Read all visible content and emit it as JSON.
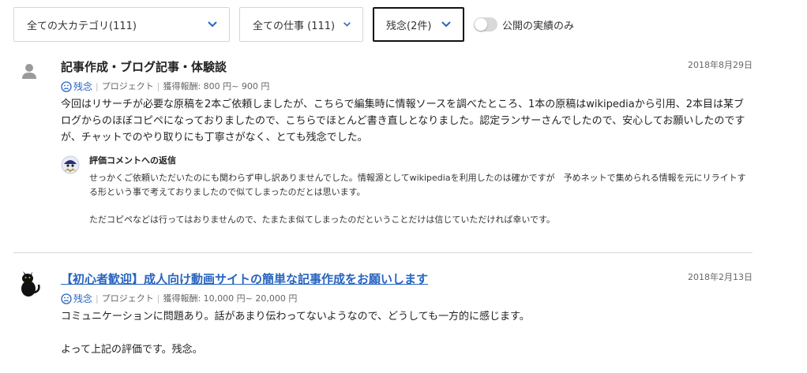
{
  "filters": {
    "category_label": "全ての大カテゴリ(111)",
    "work_label": "全ての仕事 (111)",
    "rating_label": "残念(2件)",
    "public_only_label": "公開の実績のみ",
    "public_only_on": false
  },
  "reviews": [
    {
      "title": "記事作成・ブログ記事・体験談",
      "date": "2018年8月29日",
      "rating": "残念",
      "type": "プロジェクト",
      "reward": "獲得報酬: 800 円~ 900 円",
      "body": [
        "今回はリサーチが必要な原稿を2本ご依頼しましたが、こちらで編集時に情報ソースを調べたところ、1本の原稿はwikipediaから引用、2本目は某ブログからのほぼコピペになっておりましたので、こちらでほとんど書き直しとなりました。認定ランサーさんでしたので、安心してお願いしたのですが、チャットでのやり取りにも丁寧さがなく、とても残念でした。"
      ],
      "reply": {
        "title": "評価コメントへの返信",
        "text": [
          "せっかくご依頼いただいたのにも関わらず申し訳ありませんでした。情報源としてwikipediaを利用したのは確かですが　予めネットで集められる情報を元にリライトする形という事で考えておりましたので似てしまったのだとは思います。",
          "ただコピペなどは行ってはおりませんので、たまたま似てしまったのだということだけは信じていただければ幸いです。"
        ]
      }
    },
    {
      "title": "【初心者歓迎】成人向け動画サイトの簡単な記事作成をお願いします",
      "date": "2018年2月13日",
      "rating": "残念",
      "type": "プロジェクト",
      "reward": "獲得報酬: 10,000 円~ 20,000 円",
      "body": [
        "コミュニケーションに問題あり。話があまり伝わってないようなので、どうしても一方的に感じます。",
        "よって上記の評価です。残念。"
      ]
    }
  ],
  "colors": {
    "accent": "#2764c0",
    "border": "#d6d6d6"
  }
}
